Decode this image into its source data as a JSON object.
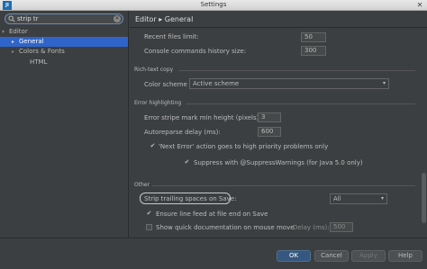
{
  "window": {
    "title": "Settings",
    "app_icon_text": "JI"
  },
  "search": {
    "value": "strip tr"
  },
  "tree": [
    {
      "label": "Editor",
      "arrow": "▾"
    },
    {
      "label": "General",
      "arrow": "▸"
    },
    {
      "label": "Colors & Fonts",
      "arrow": "▸"
    },
    {
      "label": "HTML",
      "arrow": ""
    }
  ],
  "header": {
    "title": "Editor ▸ General"
  },
  "settings": {
    "recent_files_label": "Recent files limit:",
    "recent_files_value": "50",
    "console_history_label": "Console commands history size:",
    "console_history_value": "300",
    "rich_text_section": "Rich-text copy",
    "color_scheme_label": "Color scheme",
    "color_scheme_value": "Active scheme",
    "error_section": "Error highlighting",
    "stripe_height_label": "Error stripe mark min height (pixels):",
    "stripe_height_value": "3",
    "autoreparse_label": "Autoreparse delay (ms):",
    "autoreparse_value": "600",
    "next_error_label": "'Next Error' action goes to high priority problems only",
    "suppress_label": "Suppress with @SuppressWarnings (for Java 5.0 only)",
    "other_section": "Other",
    "strip_label": "Strip trailing spaces on Save:",
    "strip_value": "All",
    "line_feed_label": "Ensure line feed at file end on Save",
    "quick_doc_label": "Show quick documentation on mouse move",
    "delay_label": "Delay (ms):",
    "delay_value": "500"
  },
  "footer": {
    "ok": "OK",
    "cancel": "Cancel",
    "apply": "Apply",
    "help": "Help"
  },
  "colors": {
    "selection": "#2f65ca",
    "primary_button": "#365880",
    "background": "#3c3f41"
  }
}
